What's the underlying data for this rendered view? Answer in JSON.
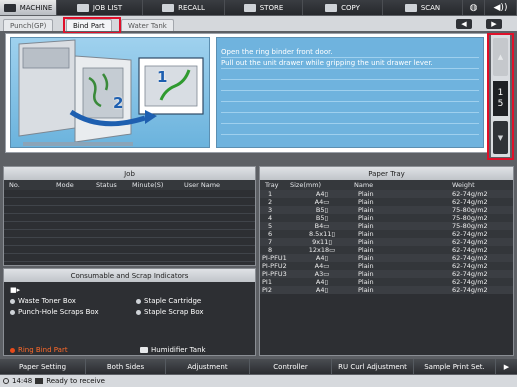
{
  "topbar": {
    "items": [
      {
        "label": "MACHINE",
        "icon": "machine-icon",
        "active": true
      },
      {
        "label": "JOB LIST",
        "icon": "job-list-icon"
      },
      {
        "label": "RECALL",
        "icon": "recall-icon"
      },
      {
        "label": "STORE",
        "icon": "store-icon"
      },
      {
        "label": "COPY",
        "icon": "copy-icon"
      },
      {
        "label": "SCAN",
        "icon": "scan-icon"
      }
    ],
    "globe": "◍",
    "volume": "◀))"
  },
  "tabs": {
    "items": [
      "Punch(GP)",
      "Bind Part",
      "Water Tank"
    ],
    "selected": "Bind Part",
    "prev": "◀",
    "next": "▶"
  },
  "instruction": {
    "line1": "Open the ring binder front door.",
    "line2": "Pull out the unit drawer while gripping the unit drawer lever.",
    "step1": "1",
    "step2": "2"
  },
  "pager": {
    "up": "▲",
    "down": "▼",
    "current": "1",
    "total": "5"
  },
  "job": {
    "title": "Job",
    "columns": [
      "No.",
      "Mode",
      "Status",
      "Minute(S)",
      "User Name"
    ]
  },
  "tray": {
    "title": "Paper Tray",
    "columns": [
      "Tray",
      "Size(mm)",
      "Name",
      "Weight"
    ],
    "rows": [
      {
        "tray": "1",
        "size": "A4▯",
        "name": "Plain",
        "weight": "62-74g/m2"
      },
      {
        "tray": "2",
        "size": "A4▭",
        "name": "Plain",
        "weight": "62-74g/m2"
      },
      {
        "tray": "3",
        "size": "B5▯",
        "name": "Plain",
        "weight": "75-80g/m2"
      },
      {
        "tray": "4",
        "size": "B5▯",
        "name": "Plain",
        "weight": "75-80g/m2"
      },
      {
        "tray": "5",
        "size": "B4▭",
        "name": "Plain",
        "weight": "75-80g/m2"
      },
      {
        "tray": "6",
        "size": "8.5x11▯",
        "name": "Plain",
        "weight": "62-74g/m2"
      },
      {
        "tray": "7",
        "size": "9x11▯",
        "name": "Plain",
        "weight": "62-74g/m2"
      },
      {
        "tray": "8",
        "size": "12x18▭",
        "name": "Plain",
        "weight": "62-74g/m2"
      },
      {
        "tray": "PI-PFU1",
        "size": "A4▯",
        "name": "Plain",
        "weight": "62-74g/m2"
      },
      {
        "tray": "PI-PFU2",
        "size": "A4▭",
        "name": "Plain",
        "weight": "62-74g/m2"
      },
      {
        "tray": "PI-PFU3",
        "size": "A3▭",
        "name": "Plain",
        "weight": "62-74g/m2"
      },
      {
        "tray": "PI1",
        "size": "A4▯",
        "name": "Plain",
        "weight": "62-74g/m2"
      },
      {
        "tray": "PI2",
        "size": "A4▯",
        "name": "Plain",
        "weight": "62-74g/m2"
      }
    ]
  },
  "consumables": {
    "title": "Consumable and Scrap Indicators",
    "items": [
      {
        "label": "",
        "icon": "toner-icon"
      },
      {
        "label": "Waste Toner Box",
        "icon": "waste-toner-icon"
      },
      {
        "label": "Punch-Hole Scraps Box",
        "icon": "punch-scraps-icon"
      },
      {
        "label": "Staple Cartridge",
        "icon": "staple-icon"
      },
      {
        "label": "Staple Scrap Box",
        "icon": "staple-scrap-icon"
      },
      {
        "label": "Ring Bind Part",
        "icon": "ring-bind-icon",
        "alert": true
      },
      {
        "label": "Humidifier Tank",
        "icon": "humidifier-icon"
      }
    ]
  },
  "bottombar": {
    "items": [
      "Paper Setting",
      "Both Sides",
      "Adjustment",
      "Controller",
      "RU Curl Adjustment",
      "Sample Print Set."
    ],
    "more": "▶"
  },
  "status": {
    "time": "14:48",
    "text": "Ready to receive"
  },
  "colors": {
    "alert": "#e84a1a",
    "highlight": "#e0102a",
    "panel_blue": "#6fb3de"
  }
}
